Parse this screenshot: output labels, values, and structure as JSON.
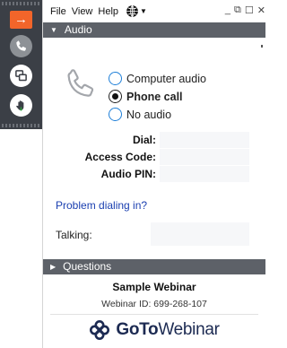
{
  "menu": {
    "file": "File",
    "view": "View",
    "help": "Help",
    "window_min": "_",
    "window_restore": "⧉",
    "window_max": "☐",
    "window_close": "✕"
  },
  "sidebar": {
    "arrow_icon": "→",
    "items": [
      {
        "name": "phone-icon"
      },
      {
        "name": "screen-share-icon"
      },
      {
        "name": "raise-hand-icon"
      }
    ],
    "accent": "#f2652a"
  },
  "audio": {
    "header": "Audio",
    "options": [
      {
        "label": "Computer audio",
        "selected": false
      },
      {
        "label": "Phone call",
        "selected": true
      },
      {
        "label": "No audio",
        "selected": false
      }
    ],
    "dial_label": "Dial:",
    "access_code_label": "Access Code:",
    "audio_pin_label": "Audio PIN:",
    "problem_link": "Problem dialing in?",
    "talking_label": "Talking:"
  },
  "questions": {
    "header": "Questions"
  },
  "footer": {
    "title": "Sample Webinar",
    "webinar_id": "Webinar ID: 699-268-107",
    "logo_goto": "GoTo",
    "logo_webinar": "Webinar"
  },
  "colors": {
    "header_bg": "#5d6168",
    "link": "#1a3fb0",
    "radio_border": "#1e7fd8"
  }
}
